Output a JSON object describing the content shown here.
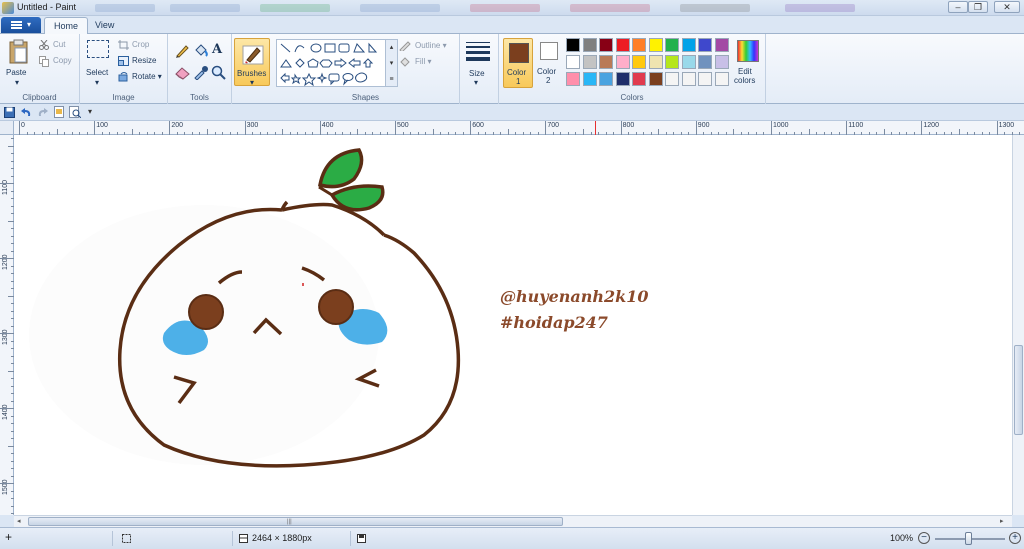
{
  "window": {
    "title": "Untitled - Paint"
  },
  "tabs": [
    {
      "label": "Home"
    },
    {
      "label": "View"
    }
  ],
  "ribbon": {
    "clipboard": {
      "paste": "Paste",
      "cut": "Cut",
      "copy": "Copy",
      "group": "Clipboard"
    },
    "image": {
      "select": "Select",
      "crop": "Crop",
      "resize": "Resize",
      "rotate": "Rotate",
      "group": "Image"
    },
    "tools": {
      "group": "Tools"
    },
    "brushes": {
      "label": "Brushes"
    },
    "shapes": {
      "outline": "Outline",
      "fill": "Fill",
      "group": "Shapes"
    },
    "size": {
      "label": "Size"
    },
    "colors": {
      "color1": "Color 1",
      "color1_num": "1",
      "color1_word": "Color",
      "color2_word": "Color",
      "color2_num": "2",
      "edit": "Edit colors",
      "edit_line1": "Edit",
      "edit_line2": "colors",
      "group": "Colors",
      "color1_value": "#7b3f1e",
      "color2_value": "#ffffff",
      "palette": [
        "#000000",
        "#7f7f7f",
        "#880015",
        "#ed1c24",
        "#ff7f27",
        "#fff200",
        "#22b14c",
        "#00a2e8",
        "#3f48cc",
        "#a349a4",
        "#ffffff",
        "#c3c3c3",
        "#b97a57",
        "#ffaec9",
        "#ffc90e",
        "#efe4b0",
        "#b5e61d",
        "#99d9ea",
        "#7092be",
        "#c8bfe7",
        "#ff8fab",
        "#29b6f6",
        "#4aa3e0",
        "#1f2f6b",
        "#e03a4e",
        "#7b3f1e",
        "#f4f4f4",
        "#f4f4f4",
        "#f4f4f4",
        "#f4f4f4"
      ]
    }
  },
  "ruler": {
    "h": [
      "0",
      "100",
      "200",
      "300",
      "400",
      "500",
      "600",
      "700",
      "800",
      "900",
      "1000",
      "1100",
      "1200",
      "1300"
    ],
    "v": [
      "1100",
      "1200",
      "1300",
      "1400",
      "1500"
    ]
  },
  "drawing": {
    "line1": "@huyenanh2k10",
    "line2": "#hoidap247"
  },
  "status": {
    "dimensions": "2464 × 1880px",
    "zoom": "100%"
  }
}
